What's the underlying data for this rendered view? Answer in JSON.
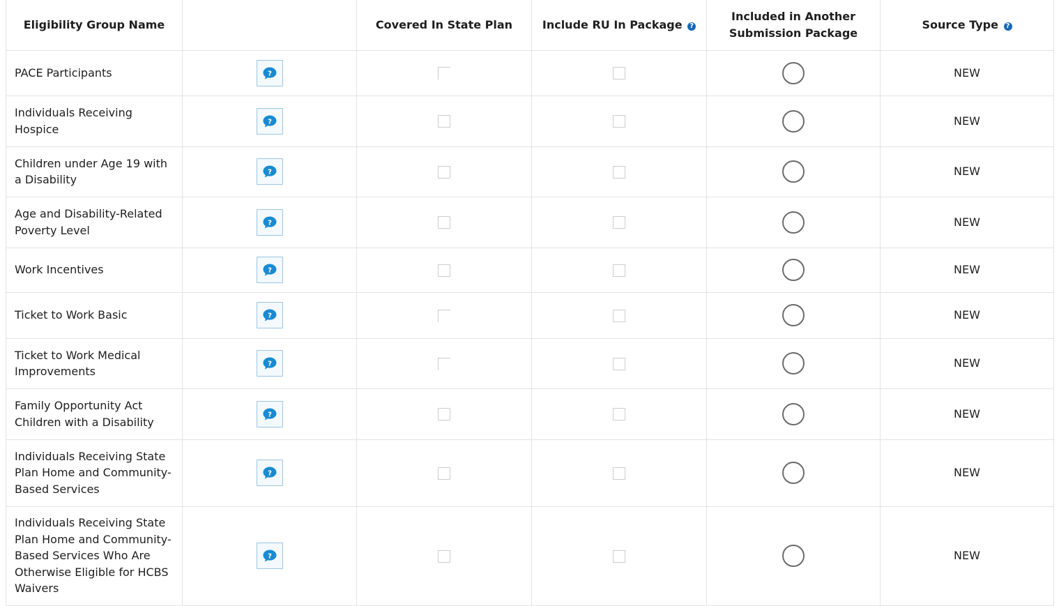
{
  "table": {
    "headers": {
      "name": "Eligibility Group Name",
      "info": "",
      "covered": "Covered In State Plan",
      "include_ru": "Include RU In Package",
      "included_other_line1": "Included in Another",
      "included_other_line2": "Submission Package",
      "source_type": "Source Type"
    },
    "help_icon": "question-circle-icon",
    "info_icon": "speech-bubble-question-icon",
    "accent_color": "#1669b8",
    "rows": [
      {
        "name": "PACE  Participants",
        "source": "NEW",
        "covered_partial": true
      },
      {
        "name": "Individuals Receiving Hospice",
        "source": "NEW",
        "covered_partial": false
      },
      {
        "name": "Children under Age 19 with a Disability",
        "source": "NEW",
        "covered_partial": false
      },
      {
        "name": "Age and Disability-Related Poverty Level",
        "source": "NEW",
        "covered_partial": false
      },
      {
        "name": "Work Incentives",
        "source": "NEW",
        "covered_partial": false
      },
      {
        "name": "Ticket to Work Basic",
        "source": "NEW",
        "covered_partial": true
      },
      {
        "name": "Ticket to Work Medical Improvements",
        "source": "NEW",
        "covered_partial": true
      },
      {
        "name": "Family Opportunity Act Children with a Disability",
        "source": "NEW",
        "covered_partial": false
      },
      {
        "name": "Individuals Receiving State Plan Home and Community-Based Services",
        "source": "NEW",
        "covered_partial": false
      },
      {
        "name": "Individuals Receiving State Plan Home and Community-Based Services Who Are Otherwise Eligible for HCBS Waivers",
        "source": "NEW",
        "covered_partial": false
      }
    ]
  }
}
